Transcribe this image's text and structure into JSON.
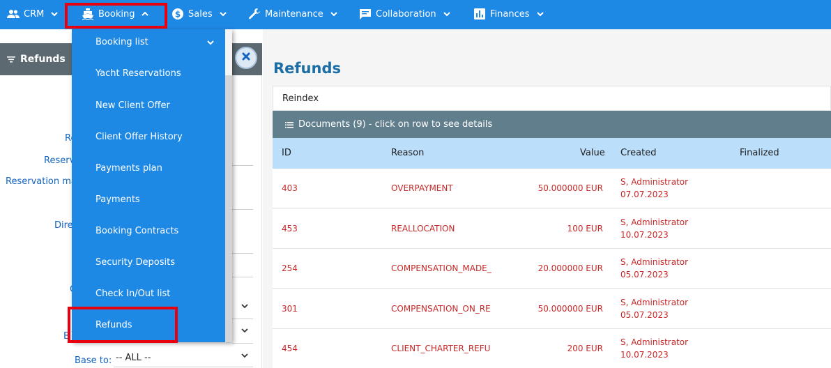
{
  "nav": {
    "items": [
      {
        "label": "CRM",
        "icon": "people-icon"
      },
      {
        "label": "Booking",
        "icon": "ship-icon"
      },
      {
        "label": "Sales",
        "icon": "dollar-icon"
      },
      {
        "label": "Maintenance",
        "icon": "wrench-icon"
      },
      {
        "label": "Collaboration",
        "icon": "chat-icon"
      },
      {
        "label": "Finances",
        "icon": "chart-icon"
      }
    ]
  },
  "dropdown": {
    "items": [
      "Booking list",
      "Yacht Reservations",
      "New Client Offer",
      "Client Offer History",
      "Payments plan",
      "Payments",
      "Booking Contracts",
      "Security Deposits",
      "Check In/Out list",
      "Refunds"
    ]
  },
  "filter": {
    "title": "Refunds",
    "labels": [
      "Re",
      "Reserv",
      "Reservation ma",
      "Dire",
      "C",
      "B",
      "Base to:"
    ],
    "base_to_value": "-- ALL --"
  },
  "main": {
    "title": "Refunds",
    "reindex_label": "Reindex",
    "documents_header": "Documents (9) - click on row to see details",
    "columns": [
      "ID",
      "Reason",
      "Value",
      "Created",
      "Finalized"
    ],
    "rows": [
      {
        "id": "403",
        "reason": "OVERPAYMENT",
        "value": "50.000000 EUR",
        "created_by": "S, Administrator",
        "created_date": "07.07.2023"
      },
      {
        "id": "453",
        "reason": "REALLOCATION",
        "value": "100 EUR",
        "created_by": "S, Administrator",
        "created_date": "10.07.2023"
      },
      {
        "id": "254",
        "reason": "COMPENSATION_MADE_",
        "value": "20.000000 EUR",
        "created_by": "S, Administrator",
        "created_date": "05.07.2023"
      },
      {
        "id": "301",
        "reason": "COMPENSATION_ON_RE",
        "value": "50.000000 EUR",
        "created_by": "S, Administrator",
        "created_date": "05.07.2023"
      },
      {
        "id": "454",
        "reason": "CLIENT_CHARTER_REFU",
        "value": "200 EUR",
        "created_by": "S, Administrator",
        "created_date": "10.07.2023"
      }
    ]
  },
  "colors": {
    "nav_bg": "#1e88e5",
    "highlight": "#e8000f",
    "title_blue": "#1c6ea4",
    "row_text": "#c62828",
    "table_header": "#bbdefb",
    "docs_header": "#617e8c"
  }
}
